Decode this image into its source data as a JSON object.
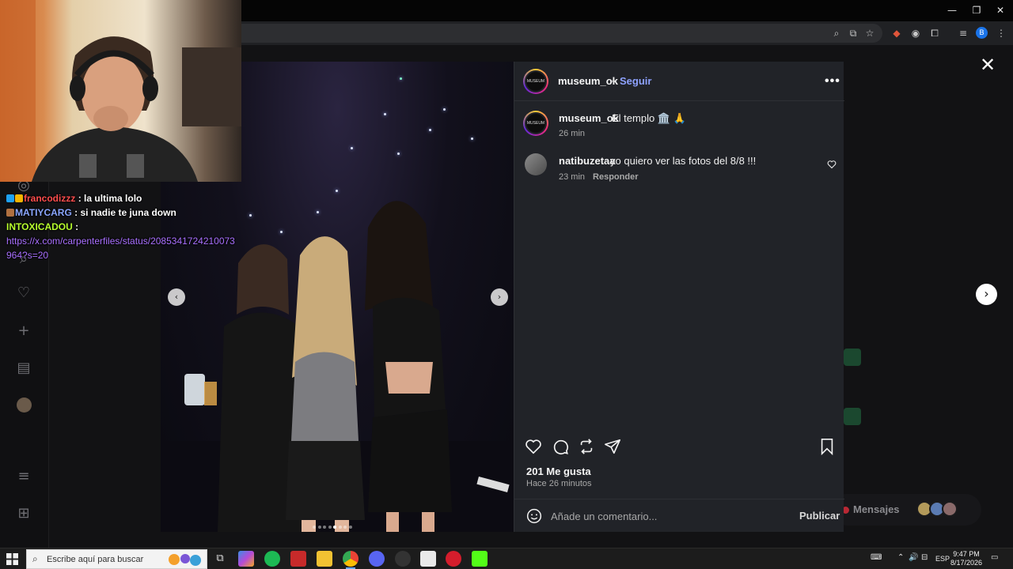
{
  "window_controls": {
    "minimize": "—",
    "restore": "❐",
    "close": "✕"
  },
  "toolbar_icons": [
    "zoom-icon",
    "install-icon",
    "star-icon",
    "extension-1-icon",
    "extension-2-icon",
    "puzzle-icon",
    "media-icon"
  ],
  "profile_initial": "B",
  "webcam": {
    "description_free": true
  },
  "chat": [
    {
      "user": "francodizzz",
      "user_color": "#ff4d4d",
      "message": ": la ultima lolo"
    },
    {
      "user": "MATIYCARG",
      "user_color": "#8aa6ff",
      "message": ": si nadie te juna down"
    },
    {
      "user": "INTOXICADOU",
      "user_color": "#b8ff2e",
      "message": ":"
    }
  ],
  "chat_link": "https://x.com/carpenterfiles/status/2085341724210073964?s=20",
  "post": {
    "author": "museum_ok",
    "avatar_text": "MUSEUM",
    "follow_label": "Seguir",
    "separator": "•",
    "more_label": "•••",
    "caption": "El templo 🏛️ 🙏",
    "caption_time": "26 min",
    "comment": {
      "user": "natibuzetaa",
      "text": "yo quiero ver las fotos del 8/8 !!!",
      "time": "23 min",
      "reply_label": "Responder"
    },
    "likes": "201 Me gusta",
    "posted_ago": "Hace 26 minutos",
    "comment_placeholder": "Añade un comentario...",
    "publish_label": "Publicar",
    "carousel": {
      "total": 8,
      "active_index": 4
    }
  },
  "background": {
    "messages_label": "Mensajes",
    "close_label": "✕",
    "next_label": "›"
  },
  "taskbar": {
    "search_placeholder": "Escribe aquí para buscar",
    "language": "ESP",
    "time": "9:47 PM",
    "date": "8/17/2026"
  },
  "colors": {
    "panel_bg": "#212328",
    "follow_blue": "#8ea2ff",
    "like_red": "#ff3040",
    "taskbar_bg": "#1c1c1c"
  }
}
